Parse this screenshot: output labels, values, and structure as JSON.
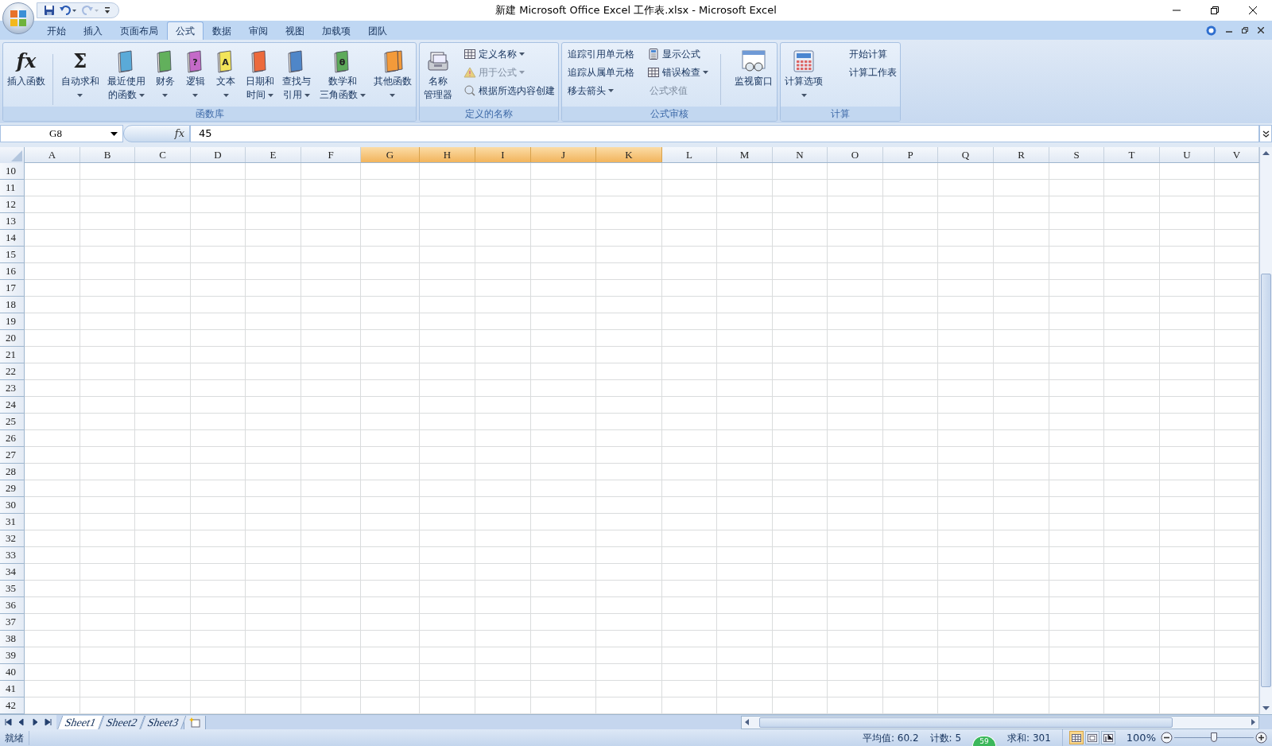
{
  "window": {
    "title": "新建 Microsoft Office Excel 工作表.xlsx - Microsoft Excel"
  },
  "quick_access": [
    {
      "kind": "save",
      "disabled": false
    },
    {
      "kind": "undo",
      "disabled": false
    },
    {
      "kind": "redo",
      "disabled": true
    },
    {
      "kind": "customize",
      "disabled": false
    }
  ],
  "tabs": [
    {
      "label": "开始",
      "selected": false
    },
    {
      "label": "插入",
      "selected": false
    },
    {
      "label": "页面布局",
      "selected": false
    },
    {
      "label": "公式",
      "selected": true
    },
    {
      "label": "数据",
      "selected": false
    },
    {
      "label": "审阅",
      "selected": false
    },
    {
      "label": "视图",
      "selected": false
    },
    {
      "label": "加载项",
      "selected": false
    },
    {
      "label": "团队",
      "selected": false
    }
  ],
  "ribbon": {
    "groups": [
      {
        "label": "函数库",
        "items": [
          {
            "kind": "large",
            "glyph": "fx",
            "lines": [
              "插入函数"
            ],
            "dropdown": false
          },
          {
            "kind": "separator"
          },
          {
            "kind": "large",
            "glyph": "Σ",
            "lines": [
              "自动求和"
            ],
            "dropdown": true
          },
          {
            "kind": "large",
            "color": "#5aaad8",
            "lines": [
              "最近使用",
              "的函数"
            ],
            "dropdown": true
          },
          {
            "kind": "large",
            "color": "#62b05c",
            "lines": [
              "财务"
            ],
            "dropdown": true
          },
          {
            "kind": "large",
            "color": "#c46ac8",
            "glyph": "?",
            "lines": [
              "逻辑"
            ],
            "dropdown": true
          },
          {
            "kind": "large",
            "color": "#f2e45a",
            "glyph": "A",
            "lines": [
              "文本"
            ],
            "dropdown": true
          },
          {
            "kind": "large",
            "color": "#ec6a3c",
            "lines": [
              "日期和",
              "时间"
            ],
            "dropdown": true
          },
          {
            "kind": "large",
            "color": "#4f86c8",
            "lines": [
              "查找与",
              "引用"
            ],
            "dropdown": true
          },
          {
            "kind": "large",
            "color": "#5daa5a",
            "glyph": "θ",
            "lines": [
              "数学和",
              "三角函数"
            ],
            "dropdown": true
          },
          {
            "kind": "large",
            "color": "#f39a3a",
            "lines": [
              "其他函数"
            ],
            "dropdown": true
          }
        ]
      },
      {
        "label": "定义的名称",
        "items": [
          {
            "kind": "large",
            "lines": [
              "名称",
              "管理器"
            ],
            "dropdown": false
          },
          {
            "kind": "stack",
            "items": [
              {
                "label": "定义名称",
                "dropdown": true,
                "disabled": false
              },
              {
                "label": "用于公式",
                "dropdown": true,
                "disabled": true
              },
              {
                "label": "根据所选内容创建",
                "dropdown": false,
                "disabled": false
              }
            ]
          }
        ]
      },
      {
        "label": "公式审核",
        "items": [
          {
            "kind": "stack",
            "items": [
              {
                "label": "追踪引用单元格",
                "dropdown": false,
                "disabled": false
              },
              {
                "label": "追踪从属单元格",
                "dropdown": false,
                "disabled": false
              },
              {
                "label": "移去箭头",
                "dropdown": true,
                "disabled": false
              }
            ]
          },
          {
            "kind": "stack",
            "items": [
              {
                "label": "显示公式",
                "dropdown": false,
                "disabled": false
              },
              {
                "label": "错误检查",
                "dropdown": true,
                "disabled": false
              },
              {
                "label": "公式求值",
                "dropdown": false,
                "disabled": true
              }
            ]
          },
          {
            "kind": "separator"
          },
          {
            "kind": "large",
            "lines": [
              "监视窗口"
            ],
            "dropdown": false
          }
        ]
      },
      {
        "label": "计算",
        "items": [
          {
            "kind": "large",
            "lines": [
              "计算选项"
            ],
            "dropdown": true
          },
          {
            "kind": "stack",
            "items": [
              {
                "label": "开始计算",
                "dropdown": false,
                "disabled": false
              },
              {
                "label": "计算工作表",
                "dropdown": false,
                "disabled": false
              }
            ]
          }
        ]
      }
    ]
  },
  "formula_bar": {
    "name_box": "G8",
    "fx": "fx",
    "formula": "45"
  },
  "sheet": {
    "columns": [
      {
        "label": "A",
        "selected": false
      },
      {
        "label": "B",
        "selected": false
      },
      {
        "label": "C",
        "selected": false
      },
      {
        "label": "D",
        "selected": false
      },
      {
        "label": "E",
        "selected": false
      },
      {
        "label": "F",
        "selected": false
      },
      {
        "label": "G",
        "selected": true
      },
      {
        "label": "H",
        "selected": true
      },
      {
        "label": "I",
        "selected": true
      },
      {
        "label": "J",
        "selected": true
      },
      {
        "label": "K",
        "selected": true
      },
      {
        "label": "L",
        "selected": false
      },
      {
        "label": "M",
        "selected": false
      },
      {
        "label": "N",
        "selected": false
      },
      {
        "label": "O",
        "selected": false
      },
      {
        "label": "P",
        "selected": false
      },
      {
        "label": "Q",
        "selected": false
      },
      {
        "label": "R",
        "selected": false
      },
      {
        "label": "S",
        "selected": false
      },
      {
        "label": "T",
        "selected": false
      },
      {
        "label": "U",
        "selected": false
      },
      {
        "label": "V",
        "selected": false
      }
    ],
    "rows": [
      "10",
      "11",
      "12",
      "13",
      "14",
      "15",
      "16",
      "17",
      "18",
      "19",
      "20",
      "21",
      "22",
      "23",
      "24",
      "25",
      "26",
      "27",
      "28",
      "29",
      "30",
      "31",
      "32",
      "33",
      "34",
      "35",
      "36",
      "37",
      "38",
      "39",
      "40",
      "41",
      "42"
    ]
  },
  "sheet_tabs": [
    {
      "label": "Sheet1",
      "selected": true
    },
    {
      "label": "Sheet2",
      "selected": false
    },
    {
      "label": "Sheet3",
      "selected": false
    }
  ],
  "status_bar": {
    "mode": "就绪",
    "stats": [
      "平均值: 60.2",
      "计数: 5",
      "求和: 301"
    ],
    "views": [
      {
        "kind": "normal",
        "selected": true
      },
      {
        "kind": "page_layout",
        "selected": false
      },
      {
        "kind": "page_break",
        "selected": false
      }
    ],
    "zoom": "100%",
    "zoom_slider": {
      "level": 0.5
    }
  },
  "badge": "59"
}
